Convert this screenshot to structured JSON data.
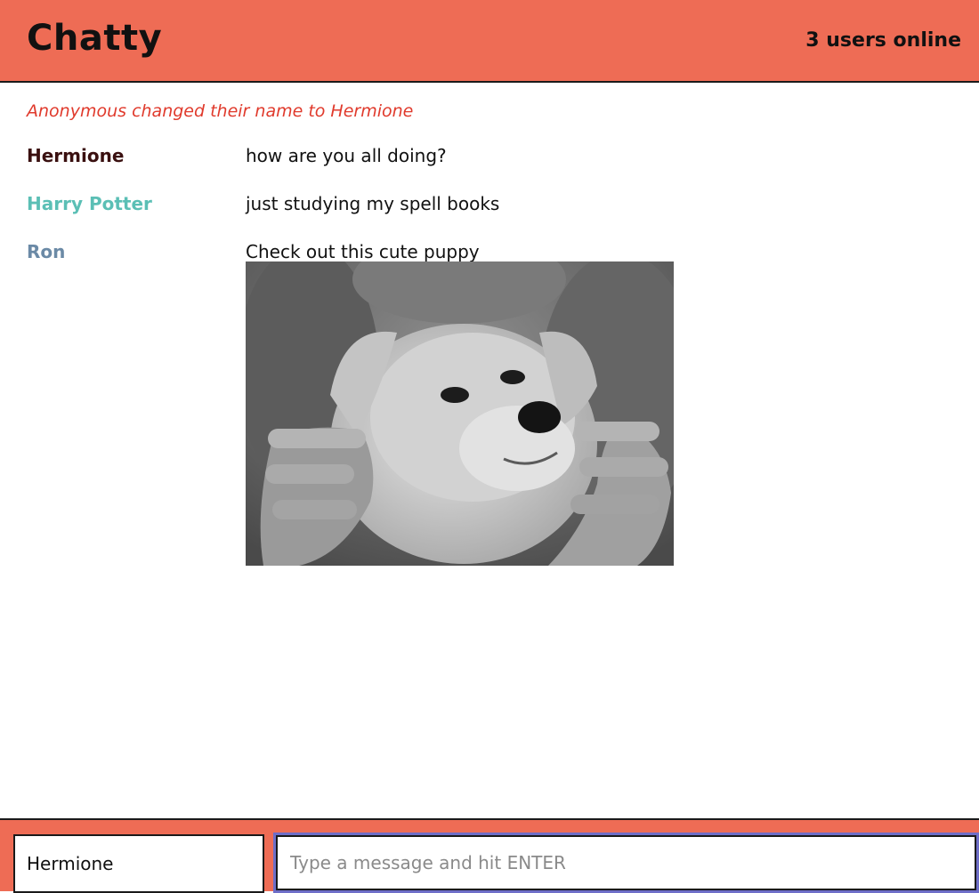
{
  "navbar": {
    "brand": "Chatty",
    "users_online": "3 users online",
    "background_color": "#ee6c55"
  },
  "system_notifications": [
    {
      "text": "Anonymous changed their name to Hermione",
      "color": "#e03a2c"
    }
  ],
  "messages": [
    {
      "username": "Hermione",
      "content": "how are you all doing?",
      "username_color": "#3a1010"
    },
    {
      "username": "Harry Potter",
      "content": "just studying my spell books",
      "username_color": "#5bbfb5"
    },
    {
      "username": "Ron",
      "content": "Check out this cute puppy",
      "username_color": "#6b8aa6",
      "image": "puppy-photo"
    }
  ],
  "footer": {
    "username_value": "Hermione",
    "message_placeholder": "Type a message and hit ENTER",
    "message_value": ""
  }
}
